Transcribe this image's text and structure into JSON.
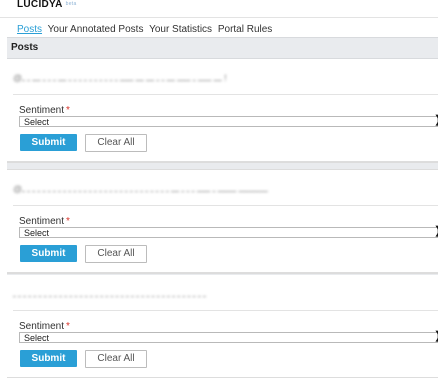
{
  "app": {
    "logo": "LUCIDYA",
    "logo_badge": "beta"
  },
  "tabs": [
    {
      "label": "Posts",
      "active": true
    },
    {
      "label": "Your Annotated Posts",
      "active": false
    },
    {
      "label": "Your Statistics",
      "active": false
    },
    {
      "label": "Portal Rules",
      "active": false
    }
  ],
  "section_title": "Posts",
  "posts": [
    {
      "text": "@ـــ ـــــ ـ ـــــ ـــ ـ ـ ـــ ـــ ـــــ ـ ـ ـ ـ ـ ـ ـ ـ ـ ـ ـــ ـ ـ ـ ـــ ـ ـ !",
      "sentiment_label": "Sentiment",
      "required_mark": "*",
      "select_value": "Select",
      "submit_label": "Submit",
      "clear_label": "Clear All"
    },
    {
      "text": "@ـــــــــــ ـــــــ ـ ـــــ ـ ـ ـ ـــ ـ ـ ـ ـ ـ ـ ـ ـ ـ ـ ـ ـ ـ ـ ـ ـ ـ ـ ـ ـ ـ ـ ـ ـ ـ ـ ـ ـ ـ",
      "sentiment_label": "Sentiment",
      "required_mark": "*",
      "select_value": "Select",
      "submit_label": "Submit",
      "clear_label": "Clear All"
    },
    {
      "text": "ـ ـ ـ ـ ـ ـ ـ ـ ـ ـ ـ ـ ـ ـ ـ ـ ـ ـ ـ ـ ـ ـ ـ ـ ـ ـ ـ ـ ـ ـ ـ ـ ـ ـ ـ ـ ـ ـ",
      "sentiment_label": "Sentiment",
      "required_mark": "*",
      "select_value": "Select",
      "submit_label": "Submit",
      "clear_label": "Clear All"
    }
  ]
}
